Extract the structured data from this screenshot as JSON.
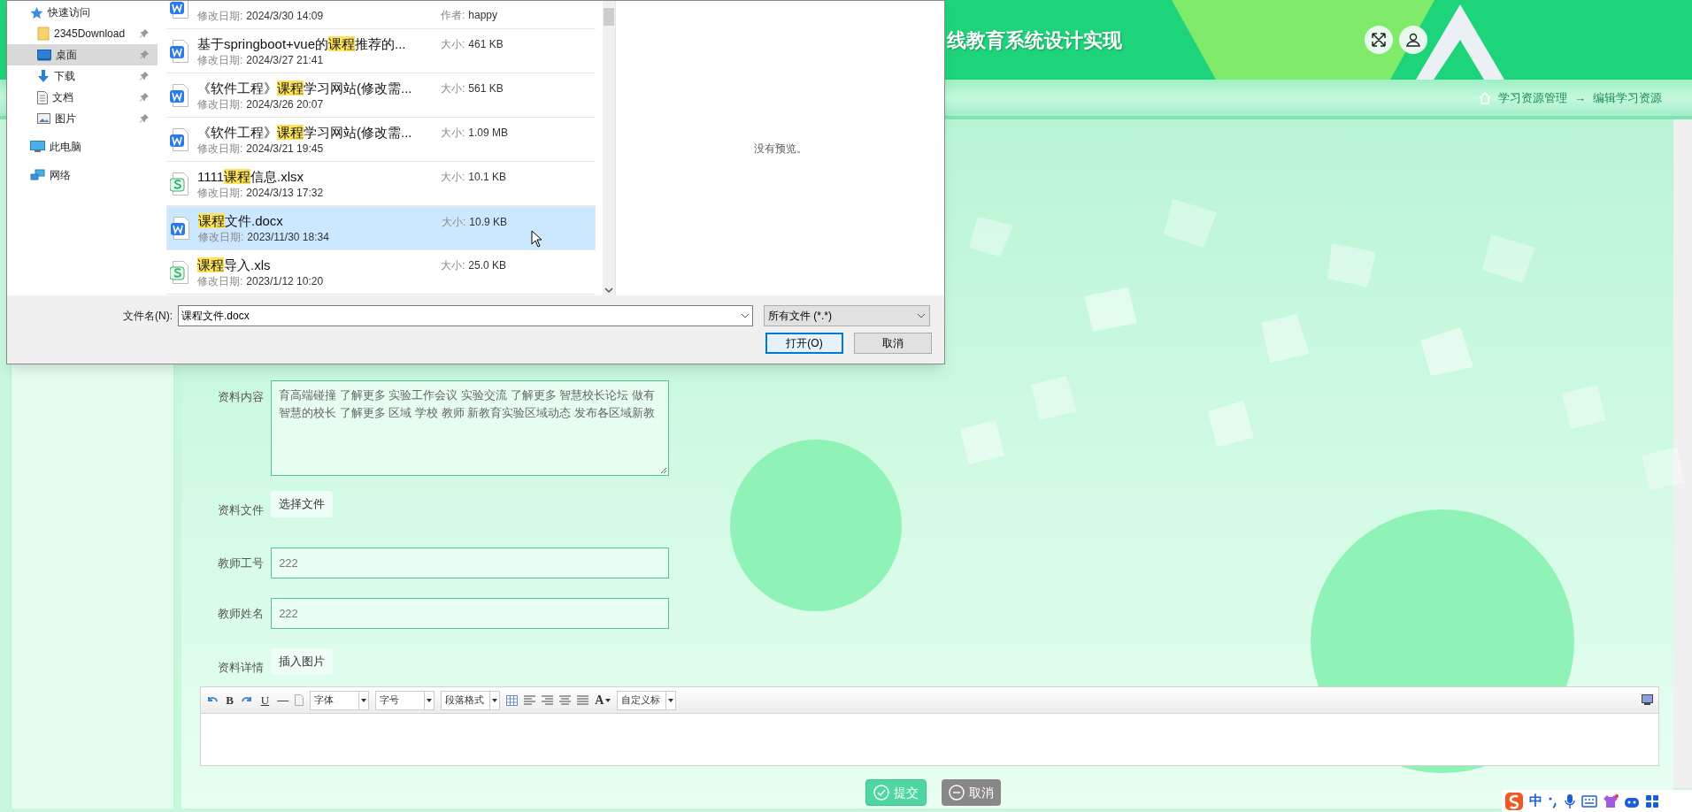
{
  "header": {
    "title": "线教育系统设计实现"
  },
  "breadcrumb": [
    "学习资源管理",
    "→",
    "编辑学习资源"
  ],
  "form": {
    "fields": [
      {
        "kind": "textarea",
        "label": "资料内容",
        "value": "育高端碰撞 了解更多 实验工作会议 实验交流 了解更多 智慧校长论坛 做有智慧的校长 了解更多 区域 学校 教师 新教育实验区域动态 发布各区域新教"
      },
      {
        "kind": "file",
        "label": "资料文件",
        "button": "选择文件"
      },
      {
        "kind": "input",
        "label": "教师工号",
        "value": "222"
      },
      {
        "kind": "input",
        "label": "教师姓名",
        "value": "222"
      },
      {
        "kind": "file",
        "label": "资料详情",
        "button": "插入图片"
      }
    ],
    "editor": {
      "toolbar": [
        {
          "kind": "undo"
        },
        {
          "kind": "bold",
          "label": "B"
        },
        {
          "kind": "redo"
        },
        {
          "kind": "underline",
          "label": "U"
        },
        {
          "kind": "rule",
          "label": "—"
        },
        {
          "kind": "page"
        },
        {
          "kind": "select",
          "label": "字体"
        },
        {
          "kind": "select",
          "label": "字号"
        },
        {
          "kind": "select",
          "label": "段落格式"
        },
        {
          "kind": "table"
        },
        {
          "kind": "align_left"
        },
        {
          "kind": "align_right"
        },
        {
          "kind": "align_center"
        },
        {
          "kind": "justify"
        },
        {
          "kind": "font_color",
          "label": "A"
        },
        {
          "kind": "select",
          "label": "自定义标"
        }
      ]
    },
    "buttons": [
      {
        "kind": "submit",
        "label": "提交"
      },
      {
        "kind": "cancel",
        "label": "取消"
      }
    ]
  },
  "file_dialog": {
    "nav": [
      {
        "kind": "star",
        "label": "快速访问",
        "selected": false,
        "children": [
          {
            "kind": "folder",
            "label": "2345Download",
            "pinned": true,
            "selected": false
          },
          {
            "kind": "desktop",
            "label": "桌面",
            "pinned": true,
            "selected": true
          },
          {
            "kind": "download",
            "label": "下载",
            "pinned": true,
            "selected": false
          },
          {
            "kind": "documents",
            "label": "文档",
            "pinned": true,
            "selected": false
          },
          {
            "kind": "pictures",
            "label": "图片",
            "pinned": true,
            "selected": false
          }
        ]
      },
      {
        "kind": "computer",
        "label": "此电脑",
        "selected": false
      },
      {
        "kind": "network",
        "label": "网络",
        "selected": false
      }
    ],
    "files": [
      {
        "kind": "word",
        "date_label": "修改日期:",
        "date": "2024/3/30 14:09",
        "info_label": "作者:",
        "info": "happy",
        "selected": false
      },
      {
        "kind": "word",
        "name": [
          {
            "text": "基于springboot+vue的",
            "highlighted": false
          },
          {
            "text": "课程",
            "highlighted": true
          },
          {
            "text": "推荐的...",
            "highlighted": false
          }
        ],
        "date_label": "修改日期:",
        "date": "2024/3/27 21:41",
        "info_label": "大小:",
        "info": "461 KB",
        "selected": false
      },
      {
        "kind": "word",
        "name": [
          {
            "text": "《软件工程》",
            "highlighted": false
          },
          {
            "text": "课程",
            "highlighted": true
          },
          {
            "text": "学习网站(修改需...",
            "highlighted": false
          }
        ],
        "date_label": "修改日期:",
        "date": "2024/3/26 20:07",
        "info_label": "大小:",
        "info": "561 KB",
        "selected": false
      },
      {
        "kind": "word",
        "name": [
          {
            "text": "《软件工程》",
            "highlighted": false
          },
          {
            "text": "课程",
            "highlighted": true
          },
          {
            "text": "学习网站(修改需...",
            "highlighted": false
          }
        ],
        "date_label": "修改日期:",
        "date": "2024/3/21 19:45",
        "info_label": "大小:",
        "info": "1.09 MB",
        "selected": false
      },
      {
        "kind": "spreadsheet",
        "name": [
          {
            "text": "1111",
            "highlighted": false
          },
          {
            "text": "课程",
            "highlighted": true
          },
          {
            "text": "信息.xlsx",
            "highlighted": false
          }
        ],
        "date_label": "修改日期:",
        "date": "2024/3/13 17:32",
        "info_label": "大小:",
        "info": "10.1 KB",
        "selected": false
      },
      {
        "kind": "word",
        "name": [
          {
            "text": "课程",
            "highlighted": true
          },
          {
            "text": "文件.docx",
            "highlighted": false
          }
        ],
        "date_label": "修改日期:",
        "date": "2023/11/30 18:34",
        "info_label": "大小:",
        "info": "10.9 KB",
        "selected": true
      },
      {
        "kind": "spreadsheet",
        "name": [
          {
            "text": "课程",
            "highlighted": true
          },
          {
            "text": "导入.xls",
            "highlighted": false
          }
        ],
        "date_label": "修改日期:",
        "date": "2023/1/12 10:20",
        "info_label": "大小:",
        "info": "25.0 KB",
        "selected": false
      }
    ],
    "preview": "没有预览。",
    "filename_label": "文件名(N):",
    "filename": "课程文件.docx",
    "filter": "所有文件 (*.*)",
    "buttons": [
      {
        "kind": "open",
        "label": "打开(O)"
      },
      {
        "kind": "cancel",
        "label": "取消"
      }
    ]
  },
  "ime_bar": {
    "mode": "中"
  }
}
